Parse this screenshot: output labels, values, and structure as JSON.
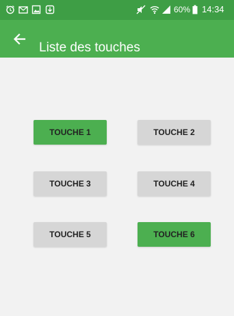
{
  "status_bar": {
    "battery_percent": "60%",
    "time": "14:34",
    "icons": [
      "alarm-icon",
      "mail-icon",
      "image-icon",
      "download-icon",
      "mute-icon",
      "wifi-icon",
      "signal-icon",
      "battery-icon"
    ]
  },
  "app_bar": {
    "title": "Liste des touches",
    "back_icon": "back-arrow-icon"
  },
  "keys": [
    {
      "label": "TOUCHE 1",
      "state": "active"
    },
    {
      "label": "TOUCHE 2",
      "state": "inactive"
    },
    {
      "label": "TOUCHE 3",
      "state": "inactive"
    },
    {
      "label": "TOUCHE 4",
      "state": "inactive"
    },
    {
      "label": "TOUCHE 5",
      "state": "inactive"
    },
    {
      "label": "TOUCHE 6",
      "state": "active"
    }
  ],
  "colors": {
    "status_bar": "#3e9e45",
    "app_bar": "#4caf50",
    "active_button": "#4caf50",
    "inactive_button": "#d6d6d6",
    "background": "#f2f2f2"
  }
}
